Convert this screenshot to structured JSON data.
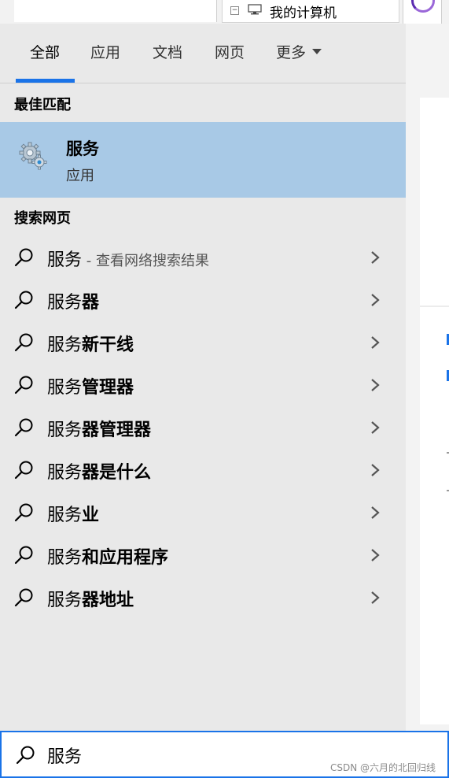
{
  "background": {
    "tree_item_label": "我的计算机",
    "tree_toggle": "−"
  },
  "tabs": [
    {
      "label": "全部",
      "active": true
    },
    {
      "label": "应用",
      "active": false
    },
    {
      "label": "文档",
      "active": false
    },
    {
      "label": "网页",
      "active": false
    },
    {
      "label": "更多",
      "active": false,
      "has_dropdown": true
    }
  ],
  "best_match": {
    "heading": "最佳匹配",
    "title": "服务",
    "subtitle": "应用",
    "icon": "services-gear-icon"
  },
  "web_search": {
    "heading": "搜索网页",
    "results": [
      {
        "prefix": "服务",
        "suffix": "",
        "hint": " - 查看网络搜索结果"
      },
      {
        "prefix": "服务",
        "suffix": "器",
        "hint": ""
      },
      {
        "prefix": "服务",
        "suffix": "新干线",
        "hint": ""
      },
      {
        "prefix": "服务",
        "suffix": "管理器",
        "hint": ""
      },
      {
        "prefix": "服务",
        "suffix": "器管理器",
        "hint": ""
      },
      {
        "prefix": "服务",
        "suffix": "器是什么",
        "hint": ""
      },
      {
        "prefix": "服务",
        "suffix": "业",
        "hint": ""
      },
      {
        "prefix": "服务",
        "suffix": "和应用程序",
        "hint": ""
      },
      {
        "prefix": "服务",
        "suffix": "器地址",
        "hint": ""
      }
    ]
  },
  "search_box": {
    "value": "服务",
    "icon": "search-icon"
  },
  "watermark": "CSDN @六月的北回归线",
  "colors": {
    "accent": "#1a73e8",
    "selection": "#a8c9e6",
    "panel_bg": "#e9e9e9"
  }
}
